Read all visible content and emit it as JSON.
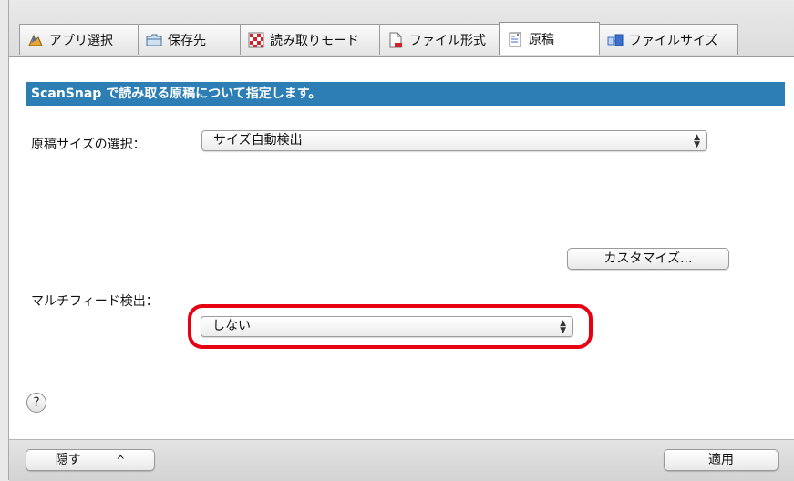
{
  "tabs": [
    {
      "label": "アプリ選択",
      "icon": "app-select-icon"
    },
    {
      "label": "保存先",
      "icon": "folder-icon"
    },
    {
      "label": "読み取りモード",
      "icon": "scan-mode-icon"
    },
    {
      "label": "ファイル形式",
      "icon": "file-format-icon"
    },
    {
      "label": "原稿",
      "icon": "paper-icon",
      "active": true
    },
    {
      "label": "ファイルサイズ",
      "icon": "file-size-icon"
    }
  ],
  "banner": "ScanSnap で読み取る原稿について指定します。",
  "paper_size": {
    "label": "原稿サイズの選択：",
    "value": "サイズ自動検出"
  },
  "customize_button": "カスタマイズ...",
  "multifeed": {
    "label": "マルチフィード検出：",
    "value": "しない"
  },
  "help_button": "?",
  "footer": {
    "hide_button": "隠す",
    "hide_chevron": "^",
    "apply_button": "適用"
  },
  "colors": {
    "banner": "#2c7eb5",
    "highlight": "#e60012"
  }
}
